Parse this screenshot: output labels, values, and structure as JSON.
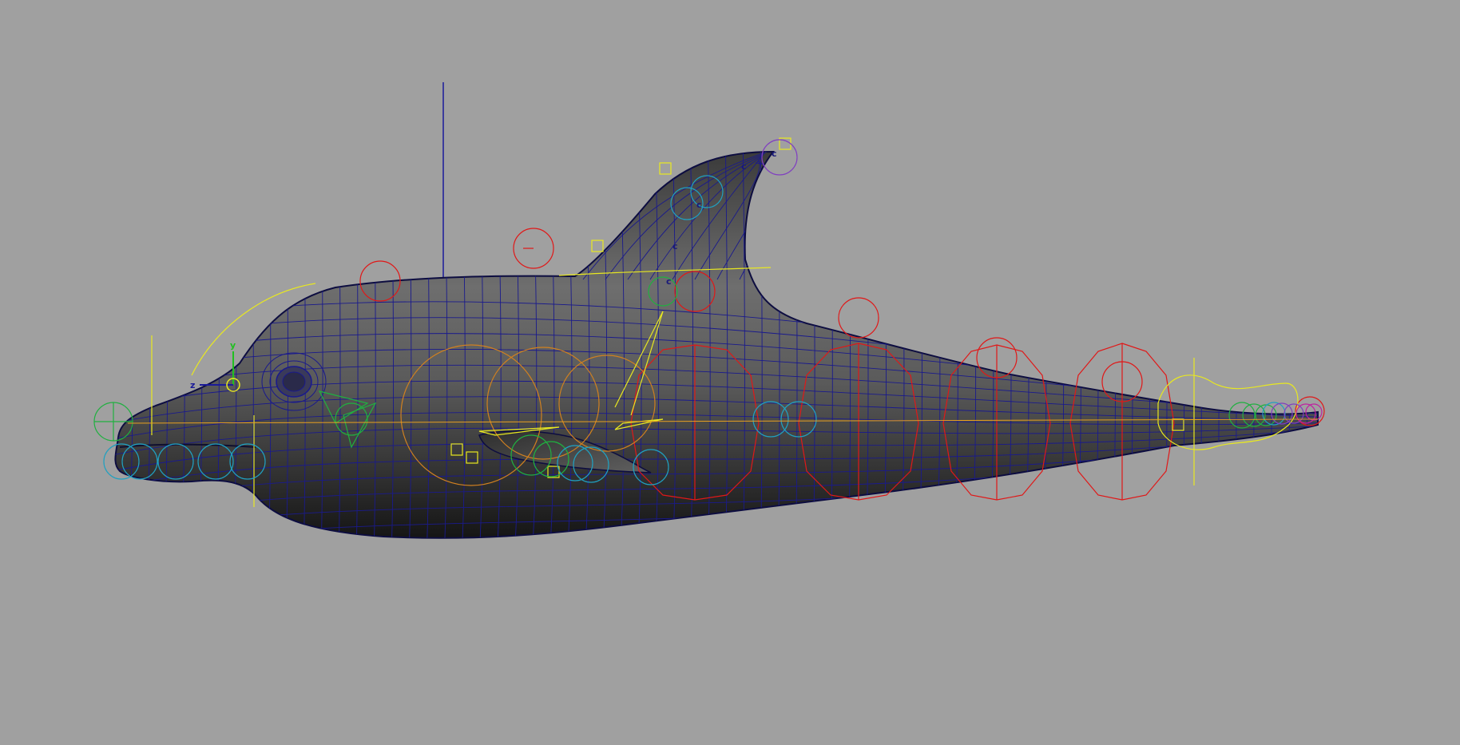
{
  "viewport": {
    "background_color": "#a0a0a0",
    "axis_labels": {
      "y": "y",
      "z": "z"
    },
    "joint_labels": [
      "c",
      "c",
      "c",
      "c",
      "c"
    ],
    "colors": {
      "mesh_wire": "#1a1a8c",
      "control_red": "#e01818",
      "control_yellow": "#e8e820",
      "control_orange": "#d08020",
      "control_green": "#20b040",
      "control_cyan": "#20a0c0",
      "control_purple": "#8040c0",
      "control_magenta": "#c020a0",
      "manipulator_blue": "#1a1a9a"
    }
  }
}
